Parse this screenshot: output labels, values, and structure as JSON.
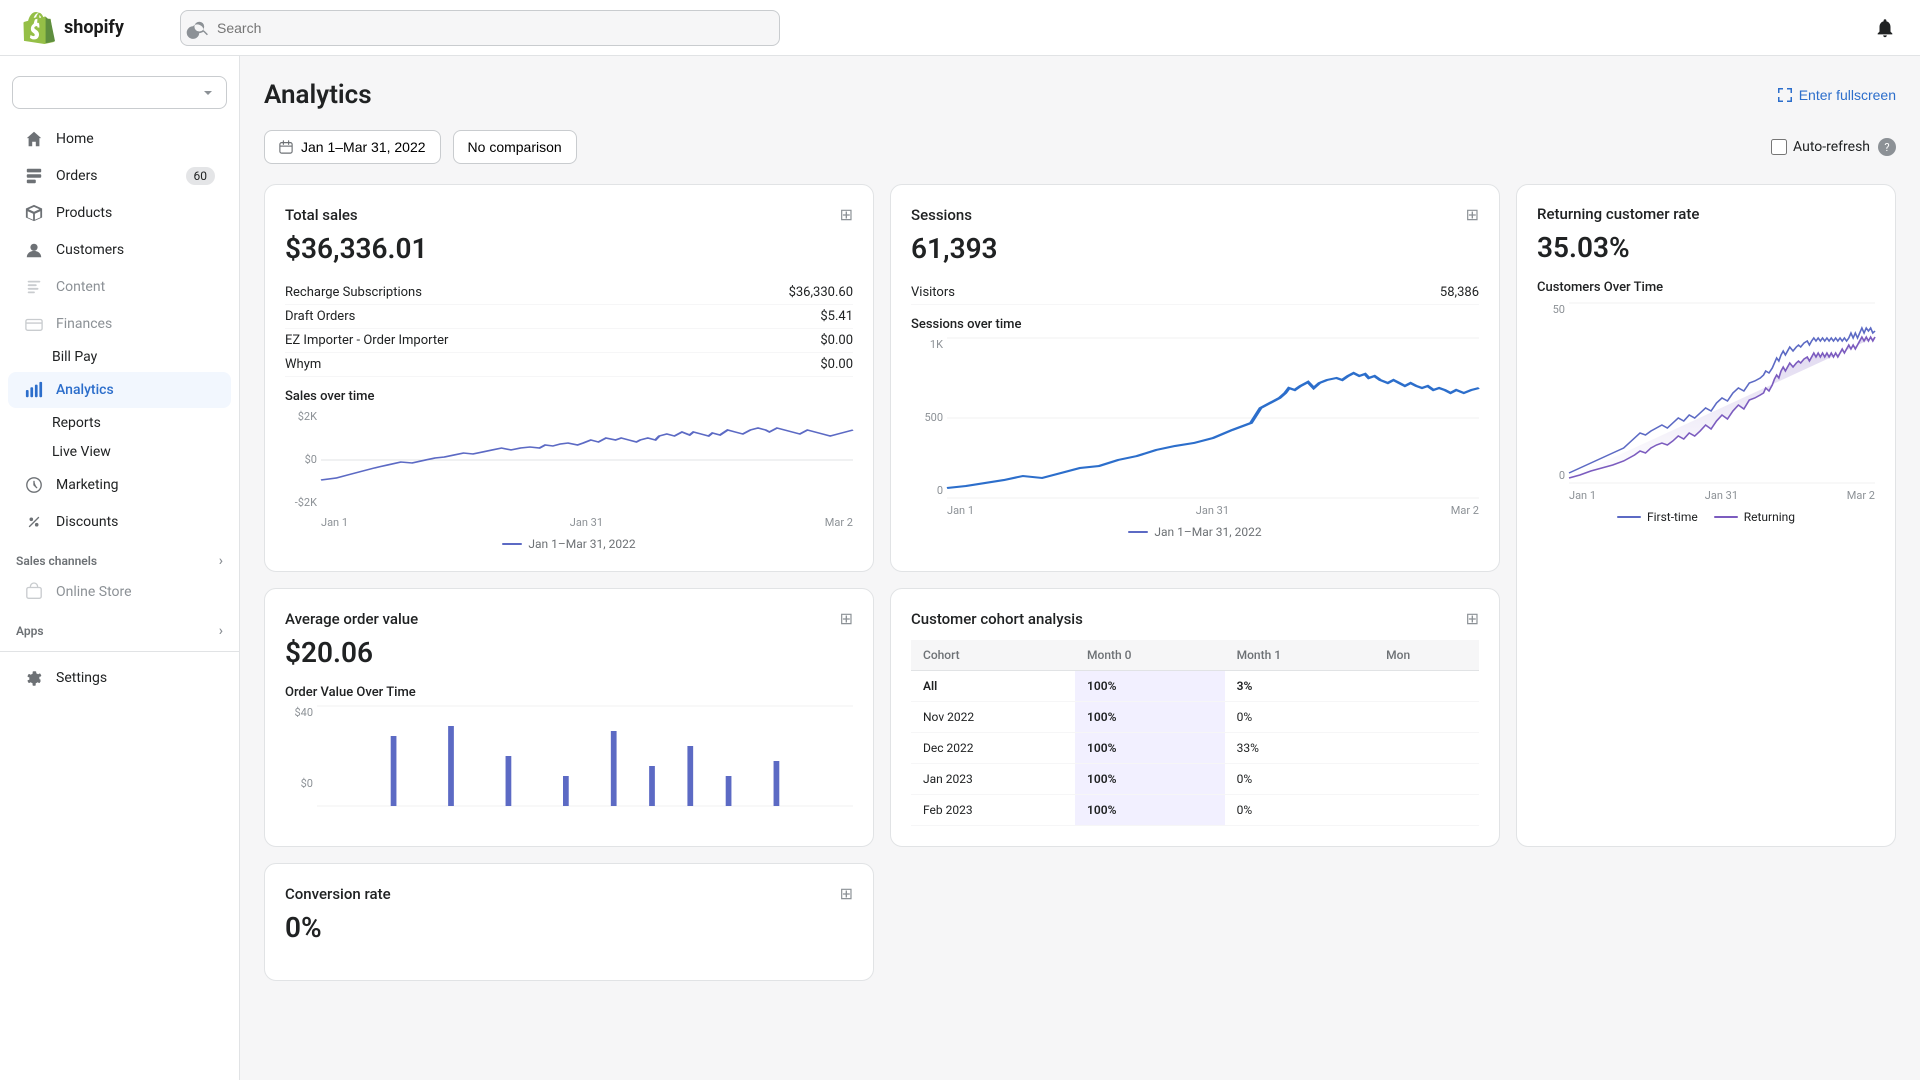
{
  "topbar": {
    "logo_text": "shopify",
    "search_placeholder": "Search"
  },
  "sidebar": {
    "store_name": "",
    "nav_items": [
      {
        "label": "Home",
        "icon": "home",
        "active": false,
        "badge": null
      },
      {
        "label": "Orders",
        "icon": "orders",
        "active": false,
        "badge": "60"
      },
      {
        "label": "Products",
        "icon": "products",
        "active": false,
        "badge": null
      },
      {
        "label": "Customers",
        "icon": "customers",
        "active": false,
        "badge": null
      },
      {
        "label": "Content",
        "icon": "content",
        "active": false,
        "badge": null,
        "disabled": true
      },
      {
        "label": "Finances",
        "icon": "finances",
        "active": false,
        "badge": null,
        "disabled": true
      },
      {
        "label": "Bill Pay",
        "icon": null,
        "active": false,
        "badge": null,
        "sub": true
      },
      {
        "label": "Analytics",
        "icon": "analytics",
        "active": true,
        "badge": null
      },
      {
        "label": "Reports",
        "icon": null,
        "active": false,
        "badge": null,
        "sub": true
      },
      {
        "label": "Live View",
        "icon": null,
        "active": false,
        "badge": null,
        "sub": true
      },
      {
        "label": "Marketing",
        "icon": "marketing",
        "active": false,
        "badge": null
      },
      {
        "label": "Discounts",
        "icon": "discounts",
        "active": false,
        "badge": null
      }
    ],
    "sales_channels_label": "Sales channels",
    "online_store_label": "Online Store",
    "apps_label": "Apps",
    "settings_label": "Settings"
  },
  "page": {
    "title": "Analytics",
    "fullscreen_label": "Enter fullscreen",
    "date_range": "Jan 1–Mar 31, 2022",
    "comparison": "No comparison",
    "auto_refresh_label": "Auto-refresh"
  },
  "total_sales": {
    "title": "Total sales",
    "value": "$36,336.01",
    "rows": [
      {
        "label": "Recharge Subscriptions",
        "value": "$36,330.60"
      },
      {
        "label": "Draft Orders",
        "value": "$5.41"
      },
      {
        "label": "EZ Importer - Order Importer",
        "value": "$0.00"
      },
      {
        "label": "Whym",
        "value": "$0.00"
      }
    ],
    "chart_label": "Sales over time",
    "y_max": "$2K",
    "y_mid": "$0",
    "y_min": "-$2K",
    "x_labels": [
      "Jan 1",
      "Jan 31",
      "Mar 2"
    ],
    "legend": "Jan 1–Mar 31, 2022"
  },
  "sessions": {
    "title": "Sessions",
    "value": "61,393",
    "visitors_label": "Visitors",
    "visitors_value": "58,386",
    "chart_label": "Sessions over time",
    "y_labels": [
      "1K",
      "500",
      "0"
    ],
    "x_labels": [
      "Jan 1",
      "Jan 31",
      "Mar 2"
    ],
    "legend": "Jan 1–Mar 31, 2022"
  },
  "returning_customer_rate": {
    "title": "Returning customer rate",
    "value": "35.03%",
    "chart_label": "Customers Over Time",
    "y_label": "50",
    "y_zero": "0",
    "x_labels": [
      "Jan 1",
      "Jan 31",
      "Mar 2"
    ],
    "legend_first": "First-time",
    "legend_returning": "Returning"
  },
  "cohort": {
    "title": "Customer cohort analysis",
    "headers": [
      "Cohort",
      "Month 0",
      "Month 1",
      "Mon"
    ],
    "rows": [
      {
        "cohort": "All",
        "month0": "100%",
        "month1": "3%",
        "extra": "",
        "is_all": true
      },
      {
        "cohort": "Nov 2022",
        "month0": "100%",
        "month1": "0%",
        "extra": ""
      },
      {
        "cohort": "Dec 2022",
        "month0": "100%",
        "month1": "33%",
        "extra": ""
      },
      {
        "cohort": "Jan 2023",
        "month0": "100%",
        "month1": "0%",
        "extra": ""
      },
      {
        "cohort": "Feb 2023",
        "month0": "100%",
        "month1": "0%",
        "extra": ""
      }
    ]
  },
  "average_order_value": {
    "title": "Average order value",
    "value": "$20.06",
    "chart_label": "Order Value Over Time",
    "y_label": "$40"
  },
  "conversion_rate": {
    "title": "Conversion rate",
    "value": "0%"
  }
}
